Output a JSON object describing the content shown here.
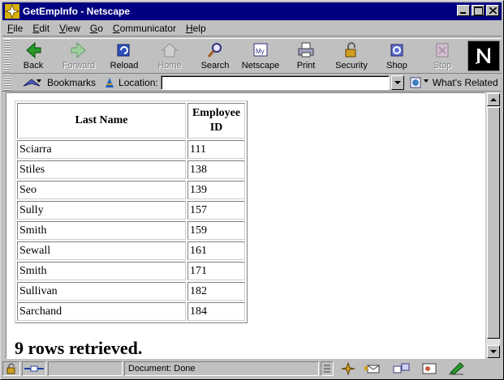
{
  "window": {
    "title": "GetEmpInfo - Netscape"
  },
  "menu": [
    "File",
    "Edit",
    "View",
    "Go",
    "Communicator",
    "Help"
  ],
  "toolbar": {
    "buttons": [
      {
        "label": "Back",
        "icon": "back-arrow-icon"
      },
      {
        "label": "Forward",
        "icon": "forward-arrow-icon"
      },
      {
        "label": "Reload",
        "icon": "reload-icon"
      },
      {
        "label": "Home",
        "icon": "home-icon"
      },
      {
        "label": "Search",
        "icon": "search-icon"
      },
      {
        "label": "Netscape",
        "icon": "netscape-icon"
      },
      {
        "label": "Print",
        "icon": "print-icon"
      },
      {
        "label": "Security",
        "icon": "lock-icon"
      },
      {
        "label": "Shop",
        "icon": "shop-icon"
      },
      {
        "label": "Stop",
        "icon": "stop-icon"
      }
    ]
  },
  "location": {
    "bookmarks_label": "Bookmarks",
    "location_label": "Location:",
    "url": "",
    "whats_related_label": "What's Related"
  },
  "table": {
    "headers": [
      "Last Name",
      "Employee ID"
    ],
    "rows": [
      [
        "Sciarra",
        "111"
      ],
      [
        "Stiles",
        "138"
      ],
      [
        "Seo",
        "139"
      ],
      [
        "Sully",
        "157"
      ],
      [
        "Smith",
        "159"
      ],
      [
        "Sewall",
        "161"
      ],
      [
        "Smith",
        "171"
      ],
      [
        "Sullivan",
        "182"
      ],
      [
        "Sarchand",
        "184"
      ]
    ]
  },
  "message": "9 rows retrieved.",
  "status": {
    "text": "Document: Done"
  },
  "colors": {
    "titlebar": "#000080",
    "chrome": "#c0c0c0"
  }
}
